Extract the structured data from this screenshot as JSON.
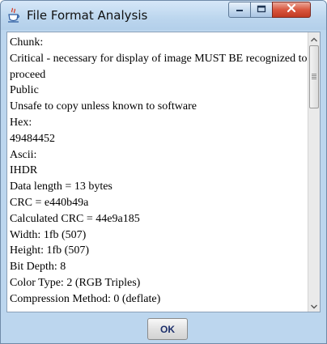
{
  "window": {
    "title": "File Format Analysis",
    "icon": "java-cup-icon"
  },
  "title_buttons": {
    "minimize_icon": "minimize-icon",
    "maximize_icon": "maximize-icon",
    "close_icon": "close-icon",
    "close_color": "#d9573f"
  },
  "content": {
    "lines": [
      "Chunk:",
      "Critical - necessary for display of image MUST BE recognized to",
      "proceed",
      "Public",
      "Unsafe to copy unless known to software",
      "Hex:",
      "49484452",
      "Ascii:",
      "IHDR",
      "Data length = 13 bytes",
      "CRC = e440b49a",
      "Calculated CRC = 44e9a185",
      "Width: 1fb (507)",
      "Height: 1fb (507)",
      "Bit Depth: 8",
      "Color Type: 2 (RGB Triples)",
      "Compression Method: 0 (deflate)"
    ]
  },
  "footer": {
    "ok_label": "OK"
  }
}
